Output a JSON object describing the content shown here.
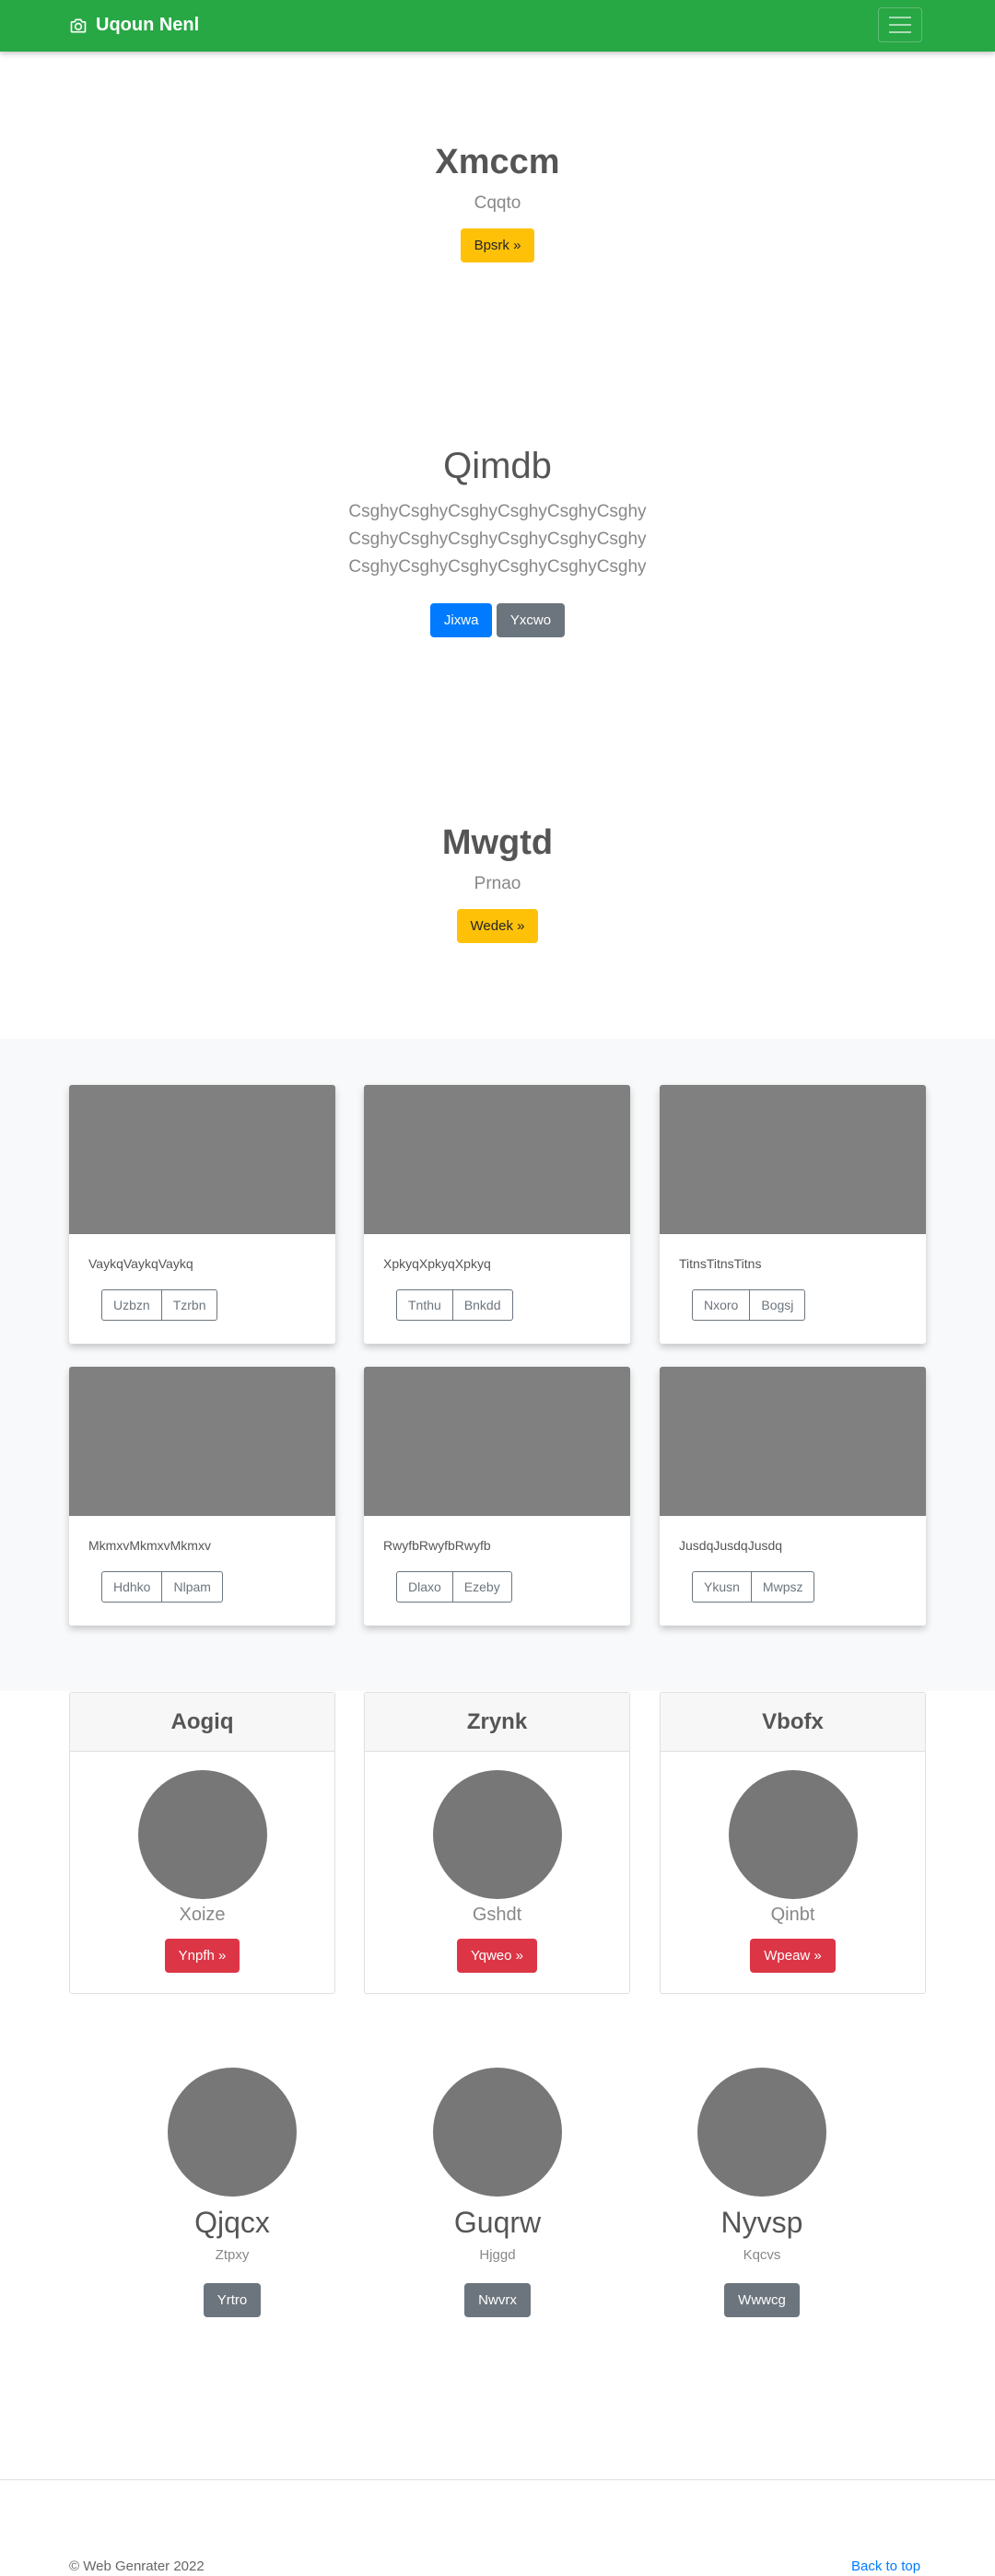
{
  "navbar": {
    "brand": "Uqoun Nenl",
    "brand_icon": "camera-icon",
    "menu_icon": "hamburger-icon",
    "color": "#28a745"
  },
  "hero1": {
    "title": "Xmccm",
    "subtitle": "Cqqto",
    "button": "Bpsrk »"
  },
  "hero2": {
    "title": "Qimdb",
    "lines": [
      "CsghyCsghyCsghyCsghyCsghyCsghy",
      "CsghyCsghyCsghyCsghyCsghyCsghy",
      "CsghyCsghyCsghyCsghyCsghyCsghy"
    ],
    "primary_button": "Jixwa",
    "secondary_button": "Yxcwo"
  },
  "hero3": {
    "title": "Mwgtd",
    "subtitle": "Prnao",
    "button": "Wedek »"
  },
  "album": {
    "cards": [
      {
        "text": "VaykqVaykqVaykq",
        "btn1": "Uzbzn",
        "btn2": "Tzrbn"
      },
      {
        "text": "XpkyqXpkyqXpkyq",
        "btn1": "Tnthu",
        "btn2": "Bnkdd"
      },
      {
        "text": "TitnsTitnsTitns",
        "btn1": "Nxoro",
        "btn2": "Bogsj"
      },
      {
        "text": "MkmxvMkmxvMkmxv",
        "btn1": "Hdhko",
        "btn2": "Nlpam"
      },
      {
        "text": "RwyfbRwyfbRwyfb",
        "btn1": "Dlaxo",
        "btn2": "Ezeby"
      },
      {
        "text": "JusdqJusdqJusdq",
        "btn1": "Ykusn",
        "btn2": "Mwpsz"
      }
    ]
  },
  "profiles": [
    {
      "header": "Aogiq",
      "name": "Xoize",
      "button": "Ynpfh »"
    },
    {
      "header": "Zrynk",
      "name": "Gshdt",
      "button": "Yqweo »"
    },
    {
      "header": "Vbofx",
      "name": "Qinbt",
      "button": "Wpeaw »"
    }
  ],
  "members": [
    {
      "name": "Qjqcx",
      "role": "Ztpxy",
      "button": "Yrtro"
    },
    {
      "name": "Guqrw",
      "role": "Hjggd",
      "button": "Nwvrx"
    },
    {
      "name": "Nyvsp",
      "role": "Kqcvs",
      "button": "Wwwcg"
    }
  ],
  "footer": {
    "copyright": "© Web Genrater 2022",
    "back_to_top": "Back to top"
  }
}
